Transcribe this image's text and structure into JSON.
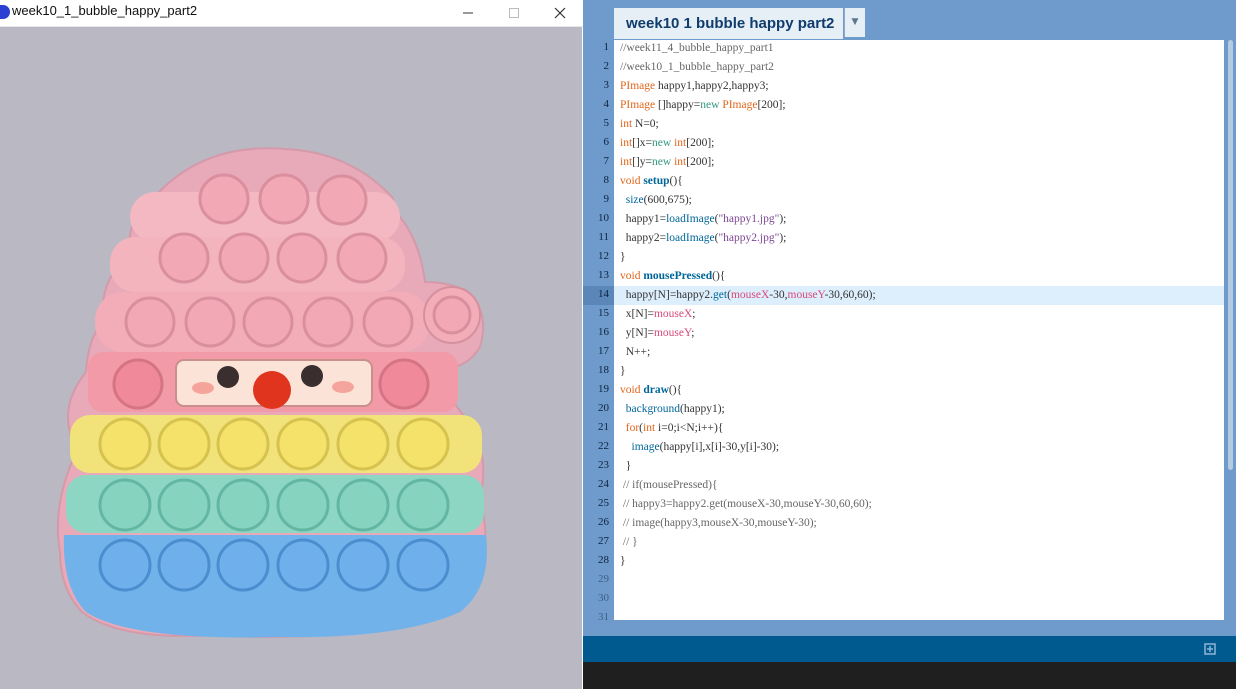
{
  "sketch_window": {
    "title": "week10_1_bubble_happy_part2",
    "controls": [
      "minimize",
      "maximize",
      "close"
    ]
  },
  "editor": {
    "tab_label": "week10 1 bubble happy part2",
    "current_line": 14,
    "visible_last_line": 31,
    "lines": [
      "//week11_4_bubble_happy_part1",
      "//week10_1_bubble_happy_part2",
      "PImage happy1,happy2,happy3;",
      "PImage []happy=new PImage[200];",
      "int N=0;",
      "int[]x=new int[200];",
      "int[]y=new int[200];",
      "void setup(){",
      "  size(600,675);",
      "  happy1=loadImage(\"happy1.jpg\");",
      "  happy2=loadImage(\"happy2.jpg\");",
      "}",
      "void mousePressed(){",
      "  happy[N]=happy2.get(mouseX-30,mouseY-30,60,60);",
      "  x[N]=mouseX;",
      "  y[N]=mouseY;",
      "  N++;",
      "}",
      "void draw(){",
      "  background(happy1);",
      "  for(int i=0;i<N;i++){",
      "    image(happy[i],x[i]-30,y[i]-30);",
      "  }",
      " // if(mousePressed){",
      " // happy3=happy2.get(mouseX-30,mouseY-30,60,60);",
      " // image(happy3,mouseX-30,mouseY-30);",
      " // }",
      "}",
      "",
      "",
      ""
    ]
  },
  "icons": {
    "app": "processing-app-icon",
    "tab_menu": "dropdown-arrow-icon",
    "console": "console-toggle-icon"
  },
  "colors": {
    "editor_blue": "#6f9bcc",
    "status_bar": "#005a8f",
    "keyword": "#e2661a",
    "function": "#006699",
    "string": "#7d4793"
  }
}
